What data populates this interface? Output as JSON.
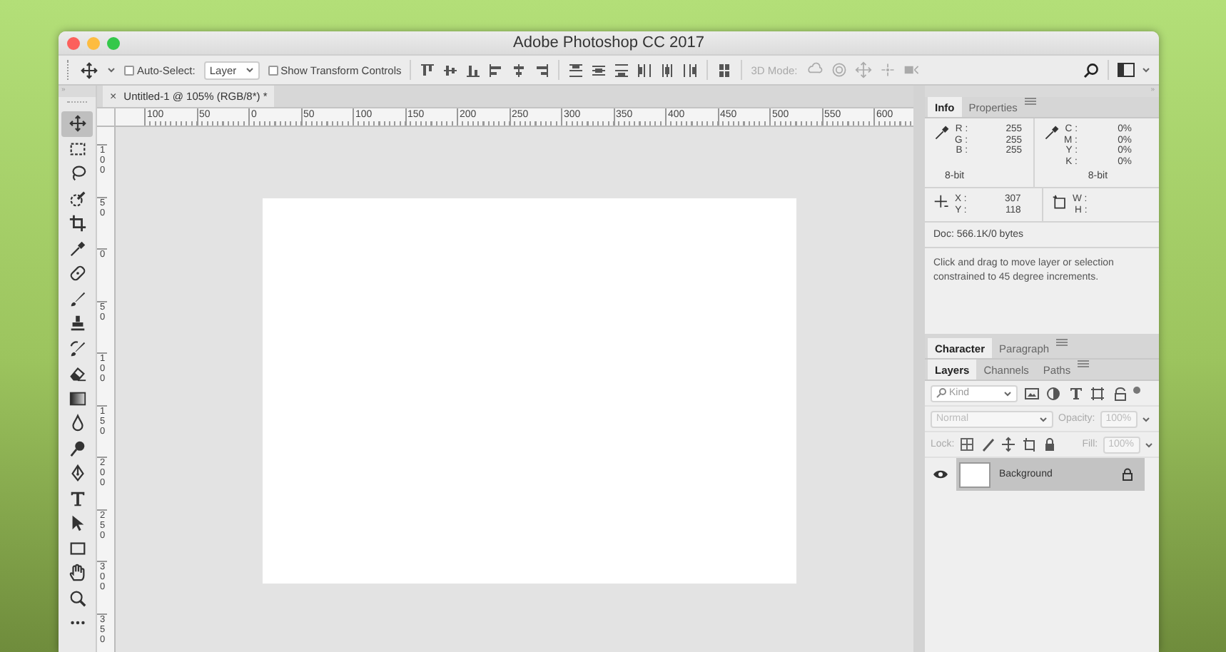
{
  "window": {
    "title": "Adobe Photoshop CC 2017"
  },
  "options_bar": {
    "auto_select": {
      "label": "Auto-Select:",
      "checked": false
    },
    "target": {
      "value": "Layer"
    },
    "transform_controls": {
      "label": "Show Transform Controls",
      "checked": false
    },
    "three_d": {
      "label": "3D Mode:",
      "disabled": true
    }
  },
  "tools_collapse": "»",
  "panels_collapse": "»",
  "tools": [
    {
      "kind": "move",
      "selected": true
    },
    {
      "kind": "marquee",
      "selected": false
    },
    {
      "kind": "lasso",
      "selected": false
    },
    {
      "kind": "quick_select",
      "selected": false
    },
    {
      "kind": "crop",
      "selected": false
    },
    {
      "kind": "eyedropper",
      "selected": false
    },
    {
      "kind": "healing",
      "selected": false
    },
    {
      "kind": "brush",
      "selected": false
    },
    {
      "kind": "stamp",
      "selected": false
    },
    {
      "kind": "history_brush",
      "selected": false
    },
    {
      "kind": "eraser",
      "selected": false
    },
    {
      "kind": "gradient",
      "selected": false
    },
    {
      "kind": "blur",
      "selected": false
    },
    {
      "kind": "dodge",
      "selected": false
    },
    {
      "kind": "pen",
      "selected": false
    },
    {
      "kind": "type",
      "selected": false
    },
    {
      "kind": "path_select",
      "selected": false
    },
    {
      "kind": "rectangle",
      "selected": false
    },
    {
      "kind": "hand",
      "selected": false
    },
    {
      "kind": "zoom",
      "selected": false
    },
    {
      "kind": "more",
      "selected": false
    }
  ],
  "document_tab": {
    "close": "×",
    "title": "Untitled-1 @ 105% (RGB/8*) *"
  },
  "ruler_horizontal": [
    "100",
    "50",
    "0",
    "50",
    "100",
    "150",
    "200",
    "250",
    "300",
    "350",
    "400",
    "450",
    "500",
    "550",
    "600"
  ],
  "ruler_vertical": [
    "100",
    "50",
    "0",
    "50",
    "100",
    "150",
    "200",
    "250",
    "300",
    "350"
  ],
  "info_panel": {
    "tabs": [
      {
        "label": "Info",
        "selected": true
      },
      {
        "label": "Properties",
        "selected": false
      }
    ],
    "rgb": [
      {
        "label": "R :",
        "value": "255"
      },
      {
        "label": "G :",
        "value": "255"
      },
      {
        "label": "B :",
        "value": "255"
      }
    ],
    "rgb_depth": "8-bit",
    "cmyk": [
      {
        "label": "C :",
        "value": "0%"
      },
      {
        "label": "M :",
        "value": "0%"
      },
      {
        "label": "Y :",
        "value": "0%"
      },
      {
        "label": "K :",
        "value": "0%"
      }
    ],
    "cmyk_depth": "8-bit",
    "position": [
      {
        "label": "X :",
        "value": "307"
      },
      {
        "label": "Y :",
        "value": "118"
      }
    ],
    "size": [
      {
        "label": "W :"
      },
      {
        "label": "H :"
      }
    ],
    "doc": "Doc: 566.1K/0 bytes",
    "hint": "Click and drag to move layer or selection constrained to 45 degree increments."
  },
  "character_panel": {
    "tabs": [
      {
        "label": "Character",
        "selected": true
      },
      {
        "label": "Paragraph",
        "selected": false
      }
    ]
  },
  "layers_panel": {
    "tabs": [
      {
        "label": "Layers",
        "selected": true
      },
      {
        "label": "Channels",
        "selected": false
      },
      {
        "label": "Paths",
        "selected": false
      }
    ],
    "filter": {
      "placeholder": "Kind"
    },
    "blend_mode": {
      "value": "Normal",
      "disabled": true
    },
    "opacity": {
      "label": "Opacity:",
      "value": "100%",
      "disabled": true
    },
    "lock_label": "Lock:",
    "fill": {
      "label": "Fill:",
      "value": "100%",
      "disabled": true
    },
    "layers": [
      {
        "name": "Background",
        "visible": true,
        "locked": true,
        "selected": true
      }
    ]
  }
}
